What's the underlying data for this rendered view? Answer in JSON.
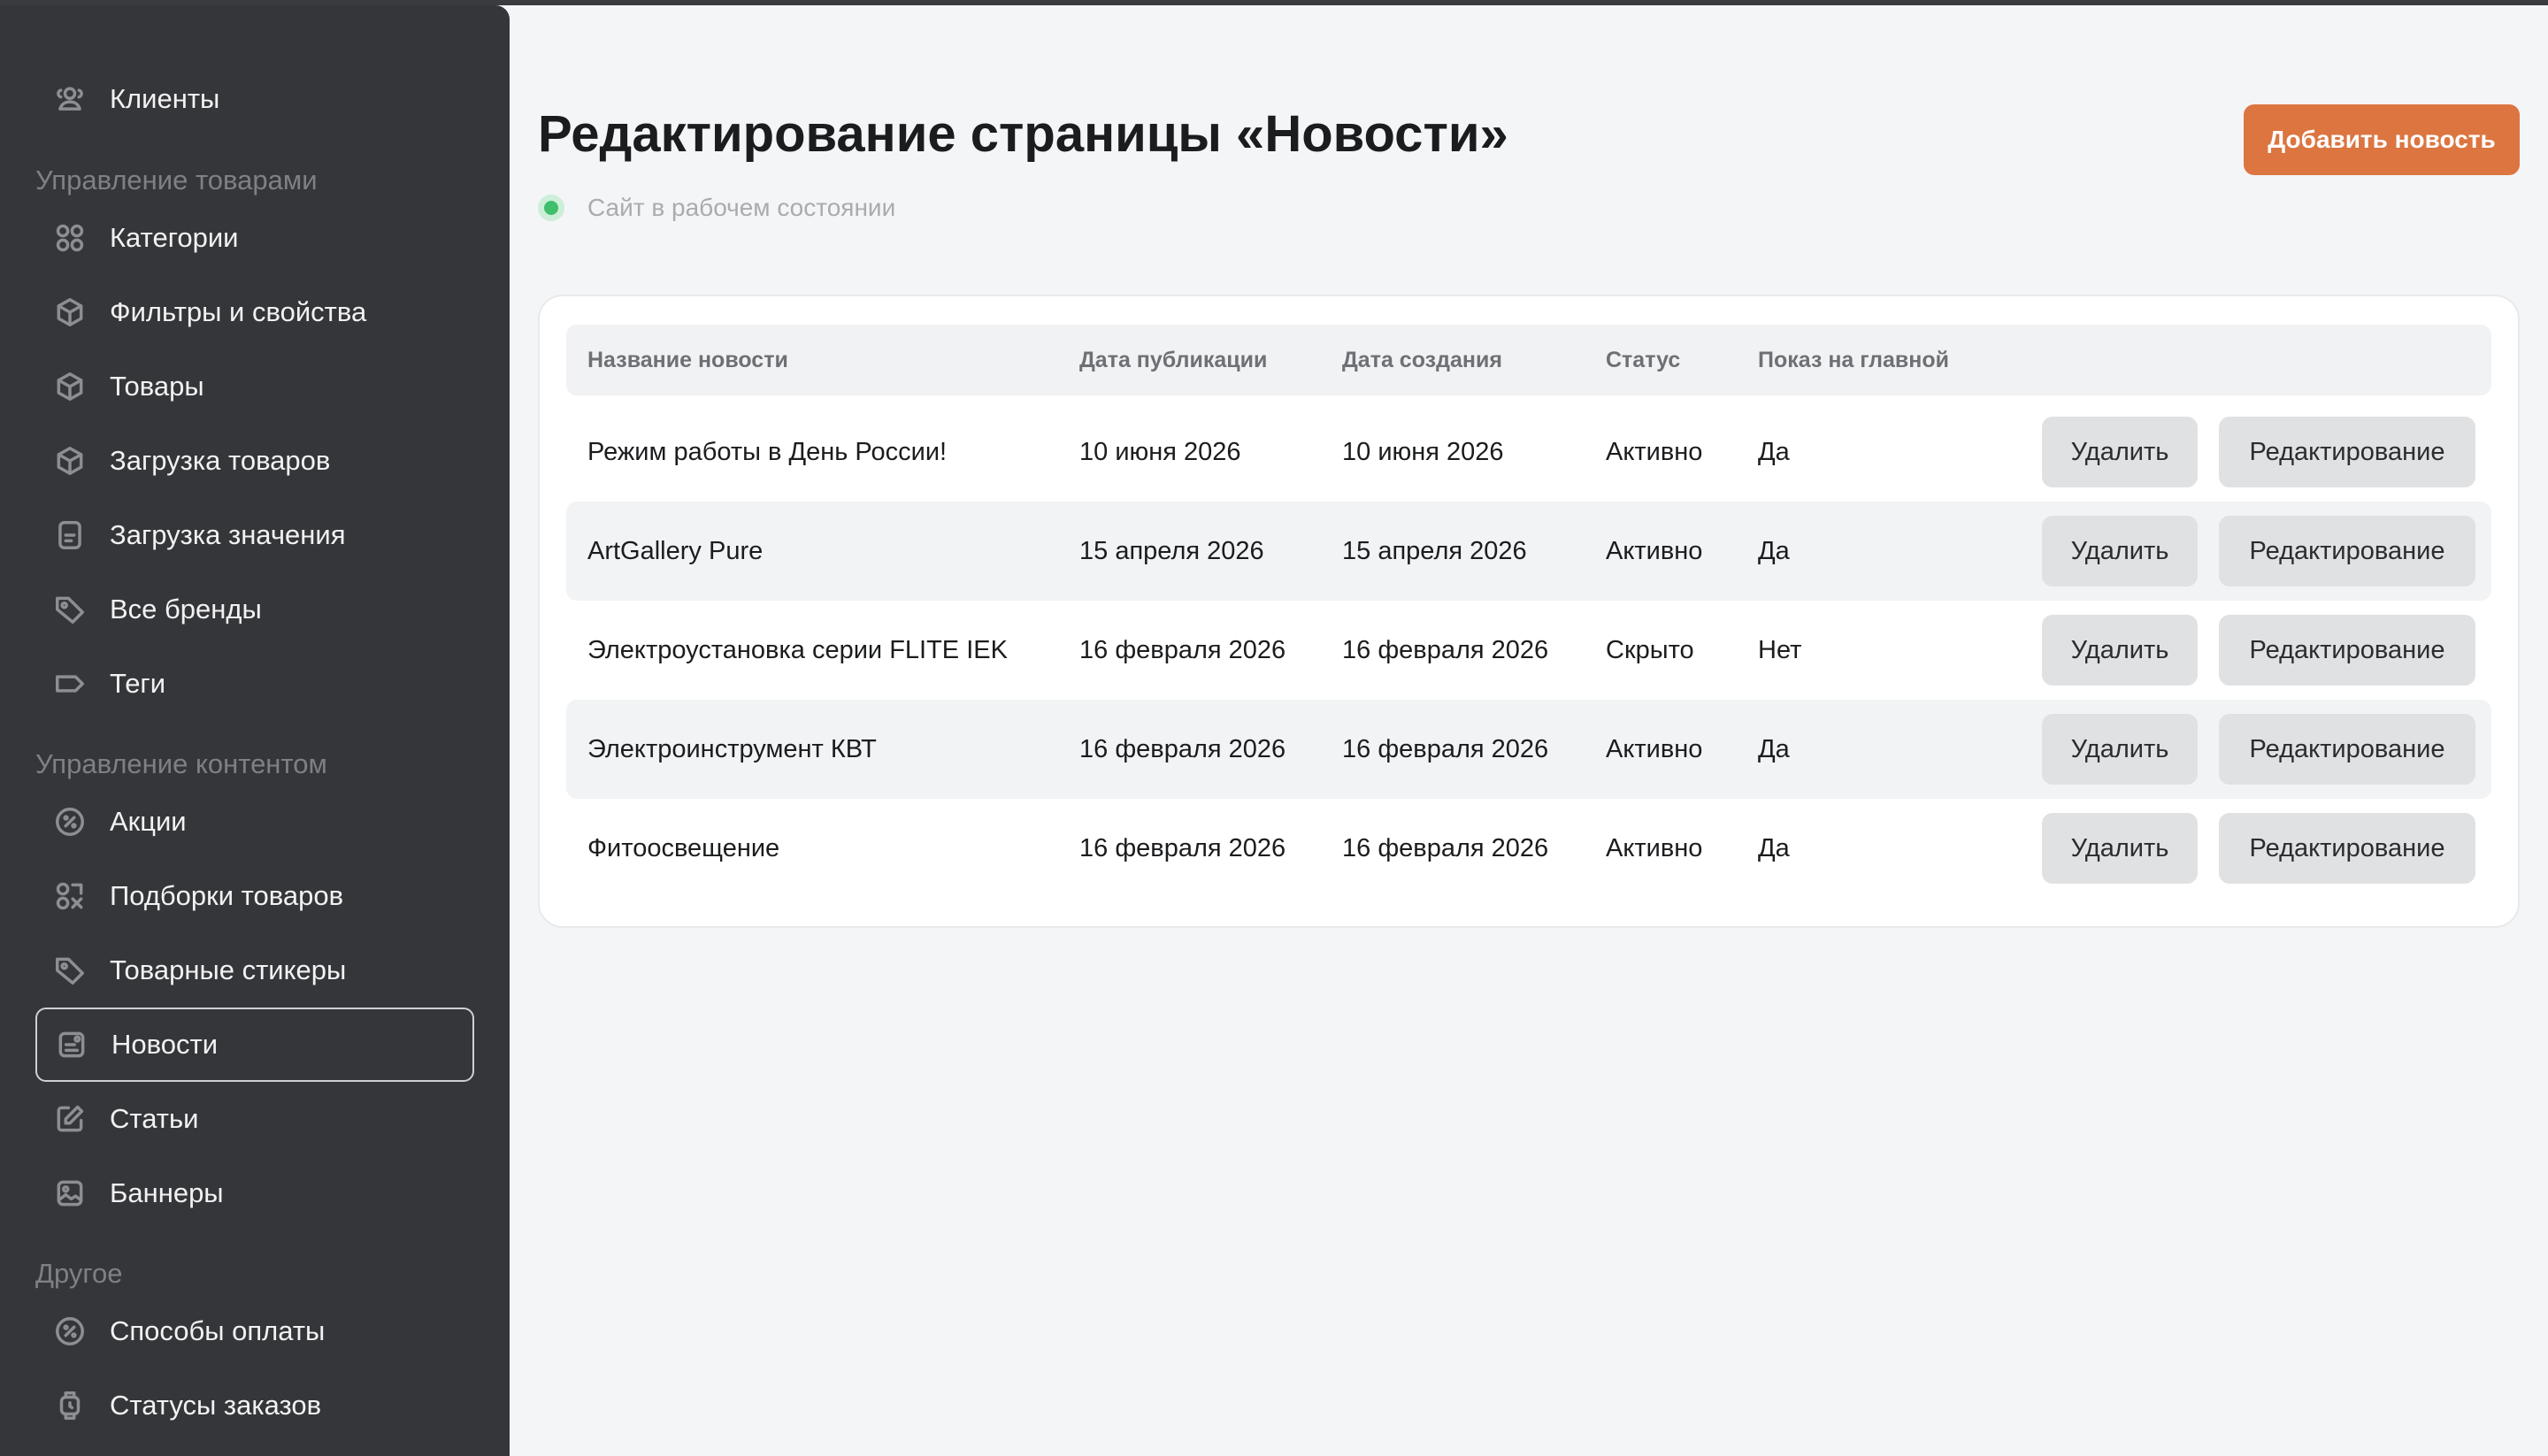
{
  "sidebar": {
    "top_item": "Клиенты",
    "sections": [
      {
        "title": "Управление товарами",
        "items": [
          "Категории",
          "Фильтры и свойства",
          "Товары",
          "Загрузка товаров",
          "Загрузка значения",
          "Все бренды",
          "Теги"
        ]
      },
      {
        "title": "Управление контентом",
        "items": [
          "Акции",
          "Подборки товаров",
          "Товарные стикеры",
          "Новости",
          "Статьи",
          "Баннеры"
        ]
      },
      {
        "title": "Другое",
        "items": [
          "Способы оплаты",
          "Статусы заказов"
        ]
      }
    ],
    "active_item": "Новости"
  },
  "header": {
    "title": "Редактирование страницы «Новости»",
    "status_text": "Сайт в рабочем состоянии",
    "add_button": "Добавить новость"
  },
  "table": {
    "headers": [
      "Название новости",
      "Дата публикации",
      "Дата создания",
      "Статус",
      "Показ на главной"
    ],
    "delete_label": "Удалить",
    "edit_label": "Редактирование",
    "rows": [
      {
        "title": "Режим работы в День России!",
        "published": "10 июня 2026",
        "created": "10 июня 2026",
        "status": "Активно",
        "on_main": "Да"
      },
      {
        "title": "ArtGallery Pure",
        "published": "15 апреля 2026",
        "created": "15 апреля 2026",
        "status": "Активно",
        "on_main": "Да"
      },
      {
        "title": "Электроустановка серии FLITE IEK",
        "published": "16 февраля 2026",
        "created": "16 февраля 2026",
        "status": "Скрыто",
        "on_main": "Нет"
      },
      {
        "title": "Электроинструмент КВТ",
        "published": "16 февраля 2026",
        "created": "16 февраля 2026",
        "status": "Активно",
        "on_main": "Да"
      },
      {
        "title": "Фитоосвещение",
        "published": "16 февраля 2026",
        "created": "16 февраля 2026",
        "status": "Активно",
        "on_main": "Да"
      }
    ]
  },
  "colors": {
    "accent": "#dc7540",
    "sidebar_bg": "#35363a",
    "status_ok": "#3fbe6b"
  }
}
